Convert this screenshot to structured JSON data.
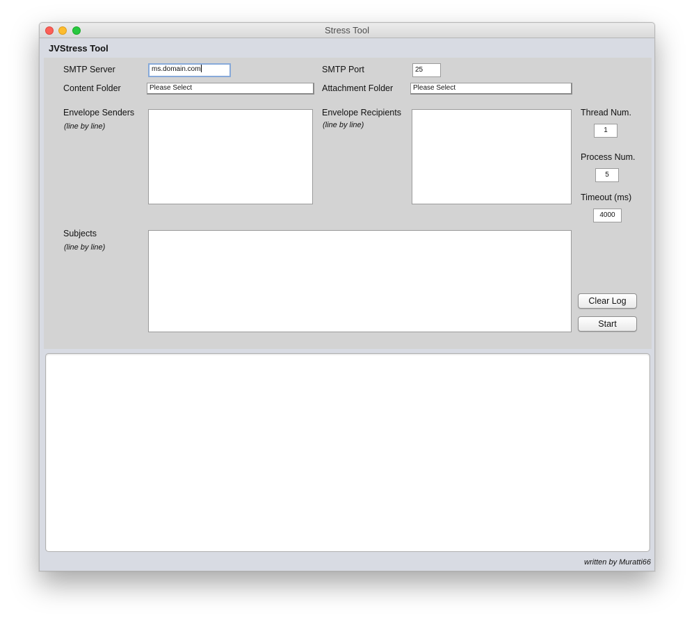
{
  "window": {
    "title": "Stress Tool"
  },
  "app": {
    "header": "JVStress Tool",
    "footer": "written by Muratti66"
  },
  "form": {
    "smtp_server": {
      "label": "SMTP Server",
      "value": "ms.domain.com"
    },
    "smtp_port": {
      "label": "SMTP Port",
      "value": "25"
    },
    "content_folder": {
      "label": "Content Folder",
      "value": "Please Select"
    },
    "attachment_folder": {
      "label": "Attachment Folder",
      "value": "Please Select"
    },
    "envelope_senders": {
      "label": "Envelope Senders",
      "hint": "(line by line)",
      "value": ""
    },
    "envelope_recipients": {
      "label": "Envelope Recipients",
      "hint": "(line by line)",
      "value": ""
    },
    "subjects": {
      "label": "Subjects",
      "hint": "(line by line)",
      "value": ""
    },
    "thread_num": {
      "label": "Thread Num.",
      "value": "1"
    },
    "process_num": {
      "label": "Process Num.",
      "value": "5"
    },
    "timeout": {
      "label": "Timeout (ms)",
      "value": "4000"
    }
  },
  "buttons": {
    "clear_log": "Clear Log",
    "start": "Start"
  },
  "log": {
    "content": ""
  },
  "colors": {
    "window_bg": "#d8dbe3",
    "panel_bg": "#d3d3d3",
    "focus_ring": "#87a9d9",
    "close": "#fc5f57",
    "minimize": "#fdbc2e",
    "maximize": "#28c840"
  }
}
